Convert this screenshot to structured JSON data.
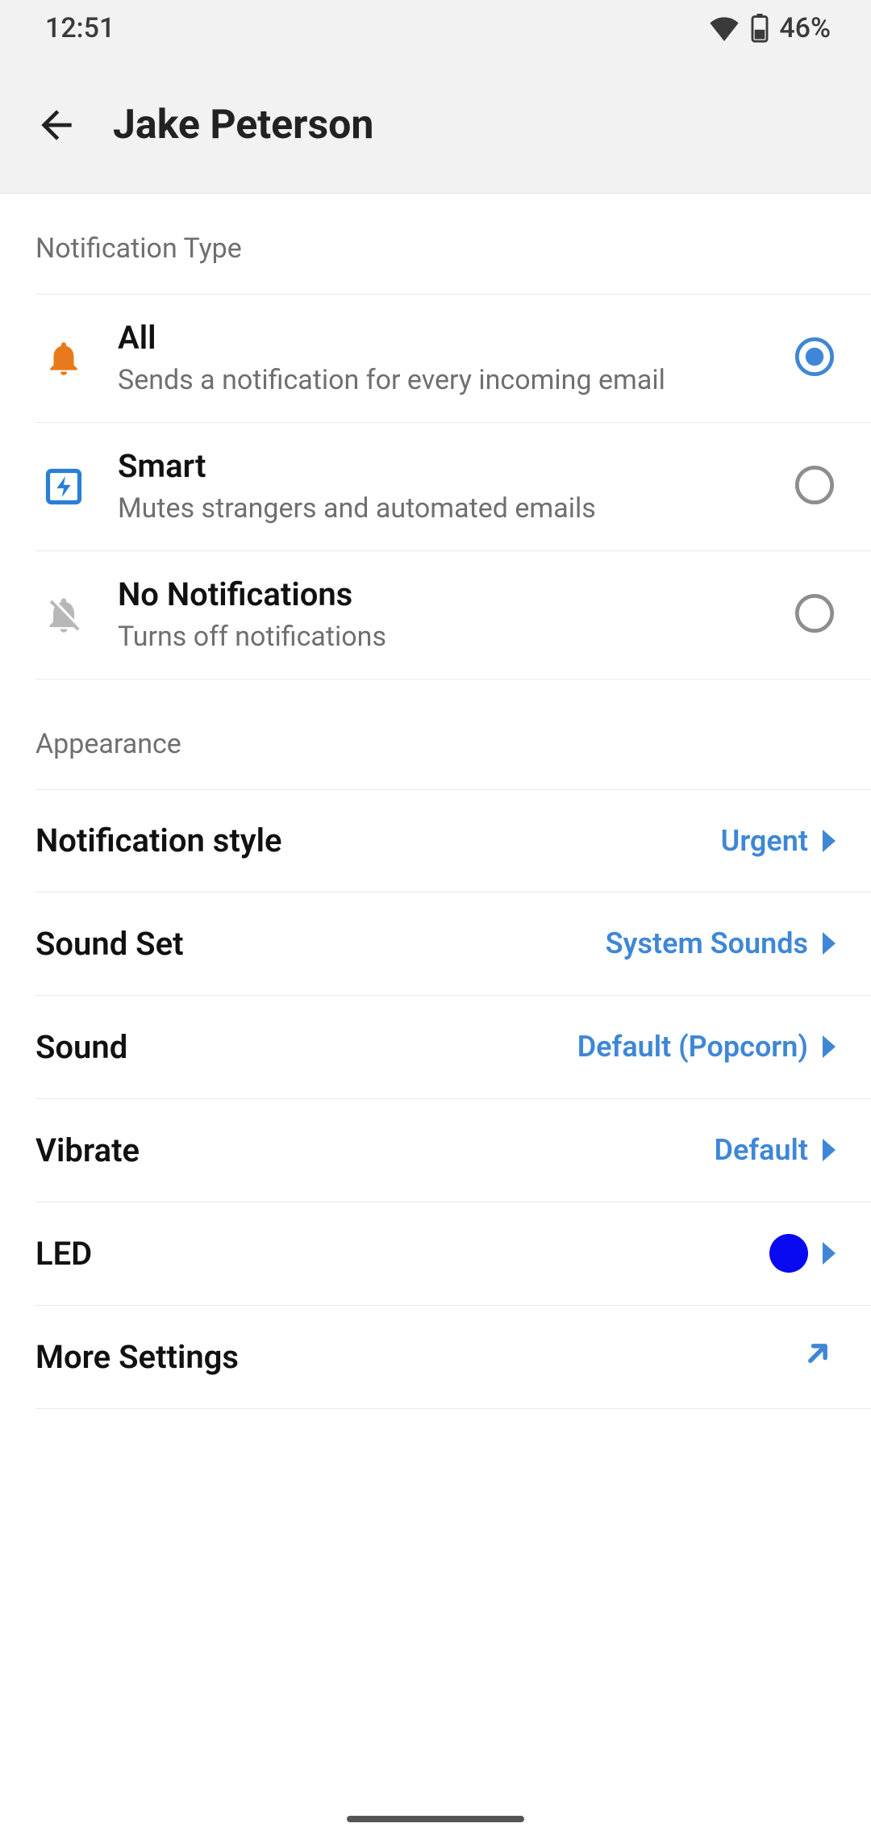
{
  "status": {
    "time": "12:51",
    "battery": "46%"
  },
  "header": {
    "title": "Jake Peterson"
  },
  "sections": {
    "notification_type": {
      "heading": "Notification Type",
      "options": [
        {
          "title": "All",
          "subtitle": "Sends a notification for every incoming email"
        },
        {
          "title": "Smart",
          "subtitle": "Mutes strangers and automated emails"
        },
        {
          "title": "No Notifications",
          "subtitle": "Turns off notifications"
        }
      ]
    },
    "appearance": {
      "heading": "Appearance",
      "rows": {
        "notification_style": {
          "label": "Notification style",
          "value": "Urgent"
        },
        "sound_set": {
          "label": "Sound Set",
          "value": "System Sounds"
        },
        "sound": {
          "label": "Sound",
          "value": "Default (Popcorn)"
        },
        "vibrate": {
          "label": "Vibrate",
          "value": "Default"
        },
        "led": {
          "label": "LED",
          "color": "#0a0af0"
        },
        "more": {
          "label": "More Settings"
        }
      }
    }
  }
}
